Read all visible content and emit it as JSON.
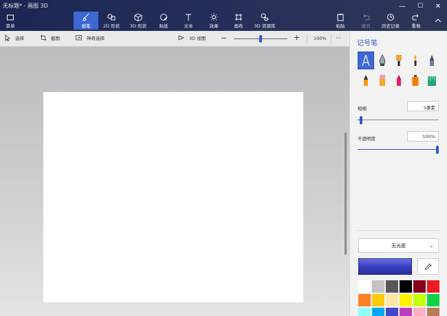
{
  "window": {
    "title": "无标题* - 画图 3D",
    "controls": {
      "minimize": "—",
      "maximize": "☐",
      "close": "✕"
    }
  },
  "ribbon": {
    "menu": "菜单",
    "tabs": [
      {
        "label": "画笔",
        "active": true
      },
      {
        "label": "2D 形状"
      },
      {
        "label": "3D 形状"
      },
      {
        "label": "贴纸"
      },
      {
        "label": "文本"
      },
      {
        "label": "效果"
      },
      {
        "label": "画布"
      },
      {
        "label": "3D 资源库"
      }
    ],
    "actions": [
      {
        "label": "粘贴"
      },
      {
        "label": "撤消",
        "disabled": true
      },
      {
        "label": "历史记录"
      },
      {
        "label": "重做"
      }
    ],
    "collapse_icon": "chevron-up-icon"
  },
  "toolbar": {
    "select": "选择",
    "crop": "截图",
    "magic_select": "神奇选择",
    "view_3d": "3D 视图",
    "zoom": "100%",
    "more": "···",
    "zoom_level": 0.5
  },
  "panel": {
    "title": "记号笔",
    "brushes": [
      "marker",
      "calligraphy-pen",
      "oil-brush",
      "watercolor",
      "pixel-pen",
      "pencil",
      "eraser",
      "crayon",
      "spray-can",
      "fill"
    ],
    "thickness": {
      "label": "粗细",
      "value": "5像素",
      "level": 0.03
    },
    "opacity": {
      "label": "不透明度",
      "value": "100%",
      "level": 1.0
    },
    "finish": "无光面",
    "current_color": "#3a40c0",
    "palette": [
      "#ffffff",
      "#c3c3c3",
      "#585858",
      "#000000",
      "#88001b",
      "#ec1c24",
      "#ff7f27",
      "#ffc90e",
      "#fde5a6",
      "#fff200",
      "#c4ff0e",
      "#0ed145",
      "#8cfffb",
      "#00a8f3",
      "#3f48cc",
      "#b83dba",
      "#ffaec8",
      "#b97a57"
    ]
  }
}
